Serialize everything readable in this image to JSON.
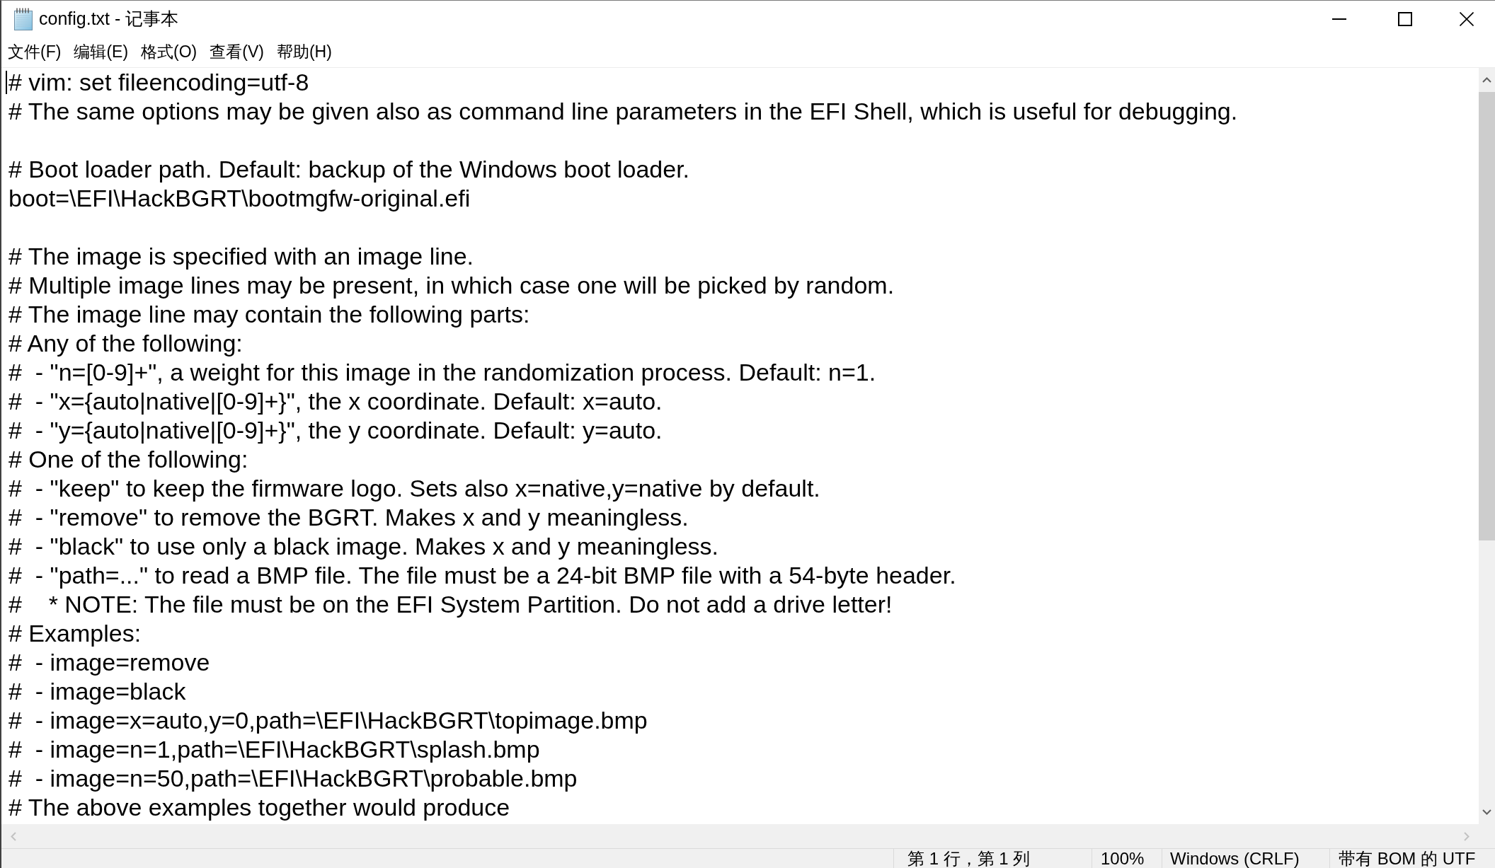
{
  "window": {
    "title": "config.txt - 记事本"
  },
  "menu_bar": [
    "文件(F)",
    "编辑(E)",
    "格式(O)",
    "查看(V)",
    "帮助(H)"
  ],
  "editor": {
    "blocks": [
      [
        "# vim: set fileencoding=utf-8",
        "# The same options may be given also as command line parameters in the EFI Shell, which is useful for debugging."
      ],
      [
        "# Boot loader path. Default: backup of the Windows boot loader.",
        "boot=\\EFI\\HackBGRT\\bootmgfw-original.efi"
      ],
      [
        "# The image is specified with an image line.",
        "# Multiple image lines may be present, in which case one will be picked by random.",
        "# The image line may contain the following parts:",
        "# Any of the following:",
        "#  - \"n=[0-9]+\", a weight for this image in the randomization process. Default: n=1.",
        "#  - \"x={auto|native|[0-9]+}\", the x coordinate. Default: x=auto.",
        "#  - \"y={auto|native|[0-9]+}\", the y coordinate. Default: y=auto.",
        "# One of the following:",
        "#  - \"keep\" to keep the firmware logo. Sets also x=native,y=native by default.",
        "#  - \"remove\" to remove the BGRT. Makes x and y meaningless.",
        "#  - \"black\" to use only a black image. Makes x and y meaningless.",
        "#  - \"path=...\" to read a BMP file. The file must be a 24-bit BMP file with a 54-byte header.",
        "#    * NOTE: The file must be on the EFI System Partition. Do not add a drive letter!",
        "# Examples:",
        "#  - image=remove",
        "#  - image=black",
        "#  - image=x=auto,y=0,path=\\EFI\\HackBGRT\\topimage.bmp",
        "#  - image=n=1,path=\\EFI\\HackBGRT\\splash.bmp",
        "#  - image=n=50,path=\\EFI\\HackBGRT\\probable.bmp",
        "# The above examples together would produce"
      ]
    ]
  },
  "status_bar": {
    "position": "第 1 行，第 1 列",
    "zoom": "100%",
    "line_ending": "Windows (CRLF)",
    "encoding": "带有 BOM 的 UTF"
  }
}
